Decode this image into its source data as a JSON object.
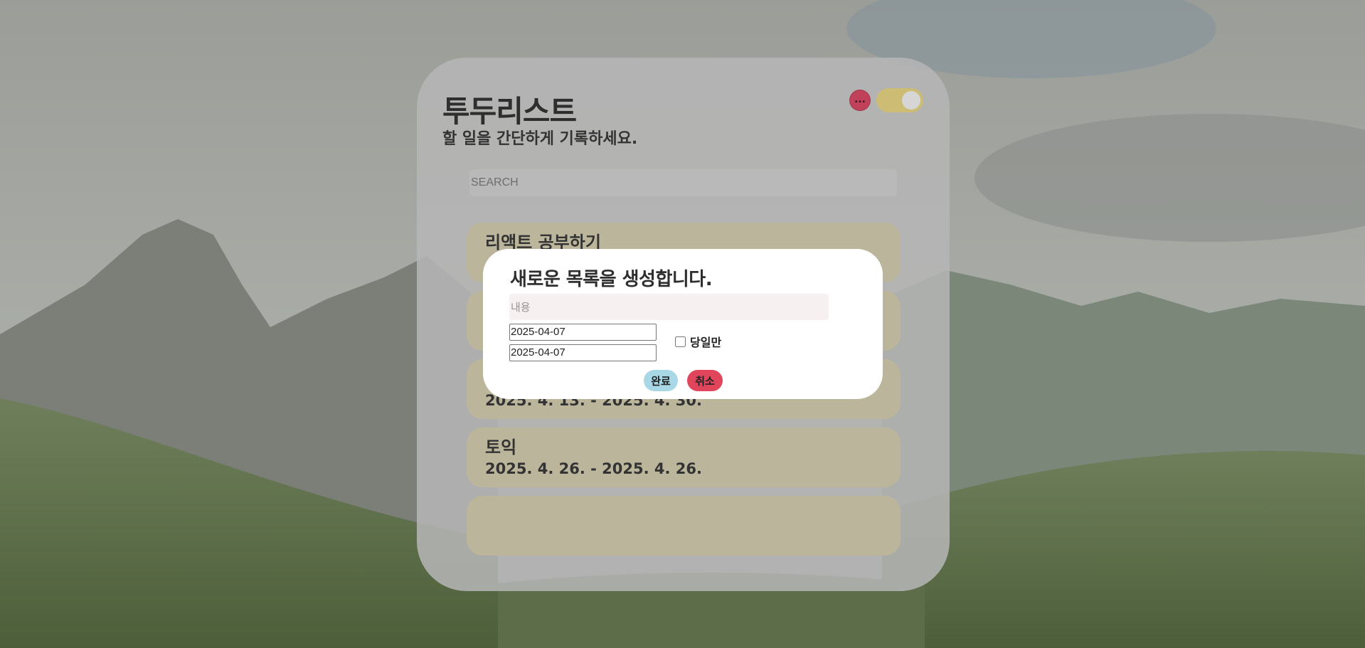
{
  "app": {
    "title": "투두리스트",
    "subtitle": "할 일을 간단하게 기록하세요.",
    "menu_label": "...",
    "theme_toggle": {
      "on": true,
      "color": "#cdbd74"
    }
  },
  "search": {
    "placeholder": "SEARCH",
    "value": ""
  },
  "todos": [
    {
      "name": "리액트 공부하기",
      "dates": ""
    },
    {
      "name": "",
      "dates": ""
    },
    {
      "name": "",
      "dates": "2025. 4. 13. - 2025. 4. 30."
    },
    {
      "name": "토익",
      "dates": "2025. 4. 26. - 2025. 4. 26."
    },
    {
      "name": "",
      "dates": ""
    }
  ],
  "modal": {
    "title": "새로운 목록을 생성합니다.",
    "content_placeholder": "내용",
    "content_value": "",
    "start_date": "2025-04-07",
    "end_date": "2025-04-07",
    "sameday_label": "당일만",
    "sameday_checked": false,
    "done_label": "완료",
    "cancel_label": "취소"
  },
  "colors": {
    "card_bg": "#b6b6b6",
    "todo_bg": "#bbb69b",
    "done_btn": "#a8d7e6",
    "cancel_btn": "#e0455c",
    "menu_btn": "#c2415a"
  }
}
